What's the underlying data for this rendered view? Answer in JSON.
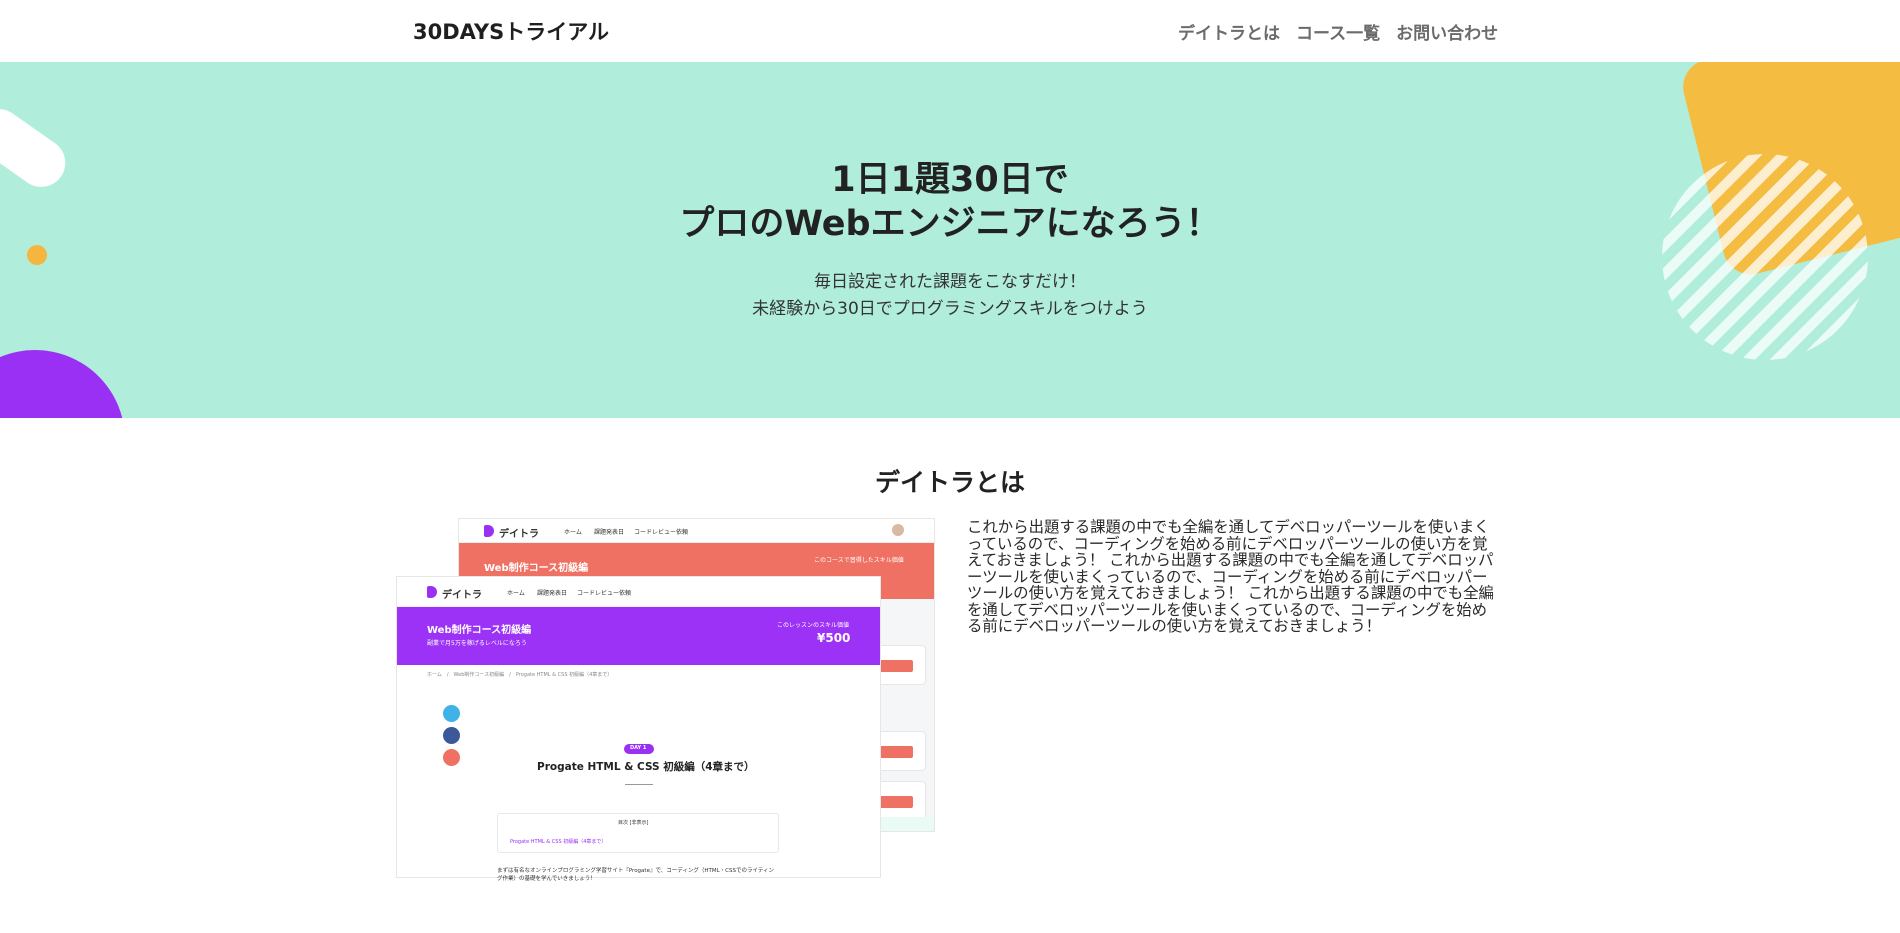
{
  "header": {
    "logo": "30DAYSトライアル",
    "nav": [
      "デイトラとは",
      "コース一覧",
      "お問い合わせ"
    ]
  },
  "hero": {
    "title_line1": "1日1題30日で",
    "title_line2": "プロのWebエンジニアになろう！",
    "subtitle_line1": "毎日設定された課題をこなすだけ！",
    "subtitle_line2": "未経験から30日でプログラミングスキルをつけよう"
  },
  "about": {
    "title": "デイトラとは",
    "body": "これから出題する課題の中でも全編を通してデベロッパーツールを使いまくっているので、コーディングを始める前にデベロッパーツールの使い方を覚えておきましょう！ これから出題する課題の中でも全編を通してデベロッパーツールを使いまくっているので、コーディングを始める前にデベロッパーツールの使い方を覚えておきましょう！ これから出題する課題の中でも全編を通してデベロッパーツールを使いまくっているので、コーディングを始める前にデベロッパーツールの使い方を覚えておきましょう！"
  },
  "screenshot": {
    "brand": "デイトラ",
    "nav_items": [
      "ホーム",
      "課題発表日",
      "コードレビュー依頼"
    ],
    "back_banner_title": "Web制作コース初級編",
    "back_banner_price_label": "このコースで習得したスキル価値",
    "front_banner_title": "Web制作コース初級編",
    "front_banner_sub": "副業で月5万を稼げるレベルになろう",
    "front_price_label": "このレッスンのスキル価値",
    "front_price": "¥500",
    "breadcrumb": "ホーム　/　Web制作コース初級編　/　Progate HTML & CSS 初級編（4章まで）",
    "day_badge": "DAY 1",
    "lesson_title": "Progate HTML & CSS 初級編（4章まで）",
    "toc_title": "目次 [非表示]",
    "toc_item": "Progate HTML & CSS 初級編（4章まで）",
    "intro": "まずは有名なオンラインプログラミング学習サイト『Progate』で、コーディング（HTML・CSSでのライティング作業）の基礎を学んでいきましょう！"
  },
  "colors": {
    "hero_bg": "#b0eedb",
    "accent_purple": "#9b30f5",
    "accent_yellow": "#f4bc41",
    "accent_red": "#ef7164"
  }
}
